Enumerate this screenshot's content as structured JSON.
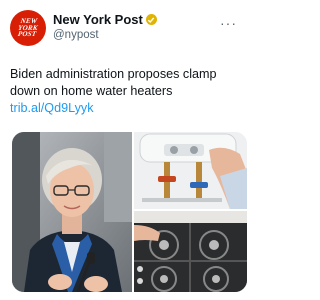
{
  "account": {
    "display_name": "New York Post",
    "handle": "@nypost",
    "avatar_lines": [
      "NEW",
      "YORK",
      "POST"
    ],
    "verified_color": "#e0b400",
    "avatar_color": "#d81e05"
  },
  "tweet": {
    "text": "Biden administration proposes clamp down on home water heaters ",
    "link": "trib.al/Qd9Lyyk"
  },
  "media": {
    "images": [
      "woman-speaking-photo",
      "water-heater-photo",
      "gas-stove-photo"
    ]
  }
}
